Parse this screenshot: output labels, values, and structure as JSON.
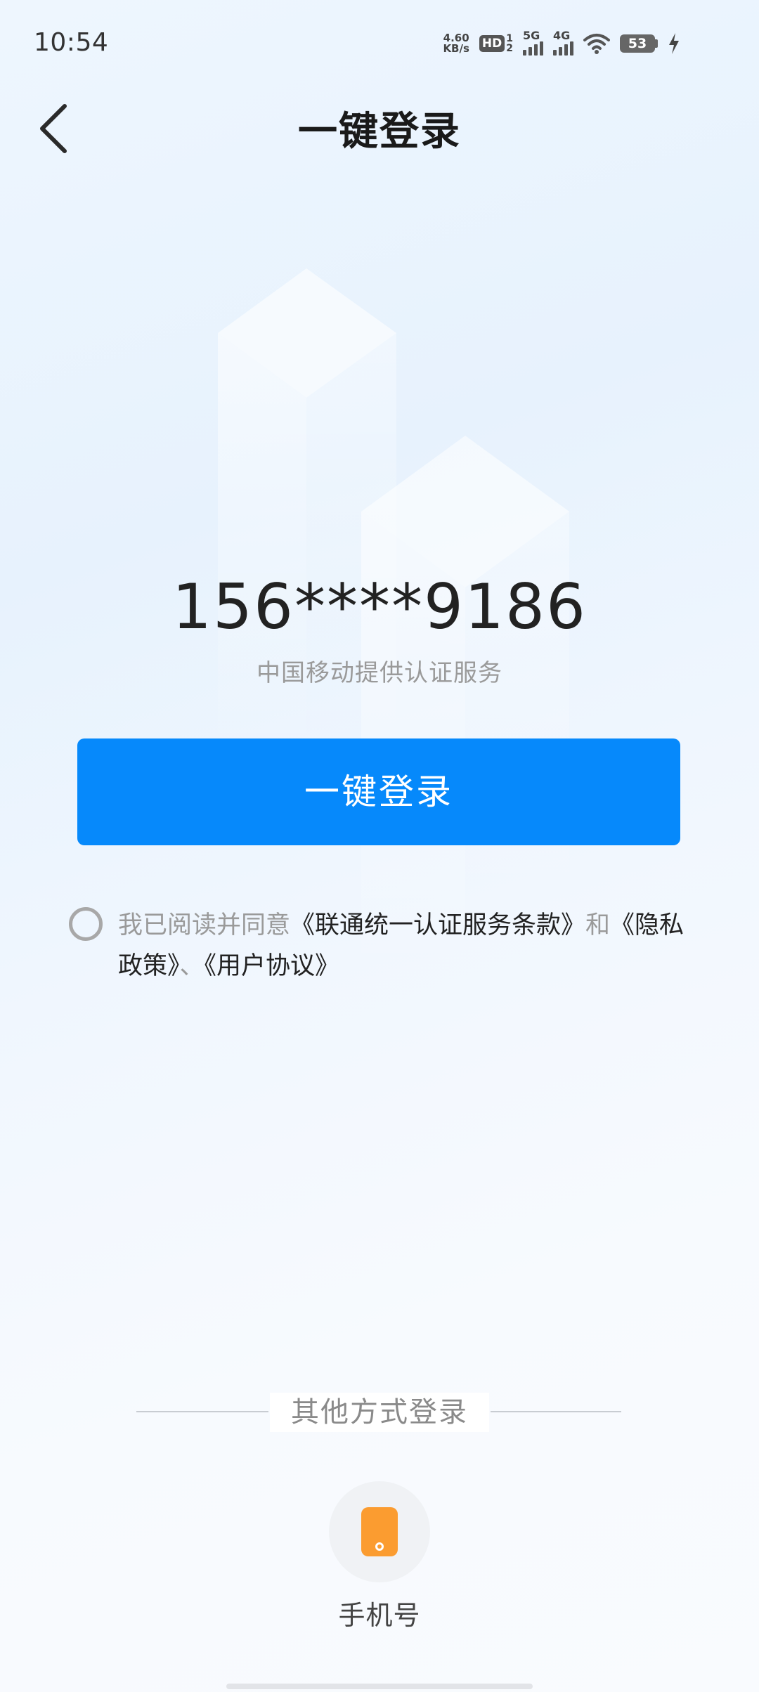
{
  "status_bar": {
    "time": "10:54",
    "net_speed_value": "4.60",
    "net_speed_unit": "KB/s",
    "hd_label": "HD",
    "hd_sub_top": "1",
    "hd_sub_bottom": "2",
    "signal1_label": "5G",
    "signal2_label": "4G",
    "battery_level": "53"
  },
  "header": {
    "title": "一键登录"
  },
  "main": {
    "phone_number": "156****9186",
    "carrier_text": "中国移动提供认证服务",
    "login_button_label": "一键登录",
    "agreement": {
      "prefix": "我已阅读并同意",
      "link_terms": "《联通统一认证服务条款》",
      "conj_and": "和",
      "link_privacy": "《隐私政策》",
      "separator": "、",
      "link_user": "《用户协议》"
    }
  },
  "other_login": {
    "label": "其他方式登录",
    "phone_label": "手机号"
  },
  "colors": {
    "accent": "#0689fb",
    "phone_icon": "#fb9c30"
  },
  "icons": {
    "back": "chevron-left-icon",
    "phone": "phone-icon",
    "wifi": "wifi-icon",
    "charging": "lightning-icon"
  }
}
